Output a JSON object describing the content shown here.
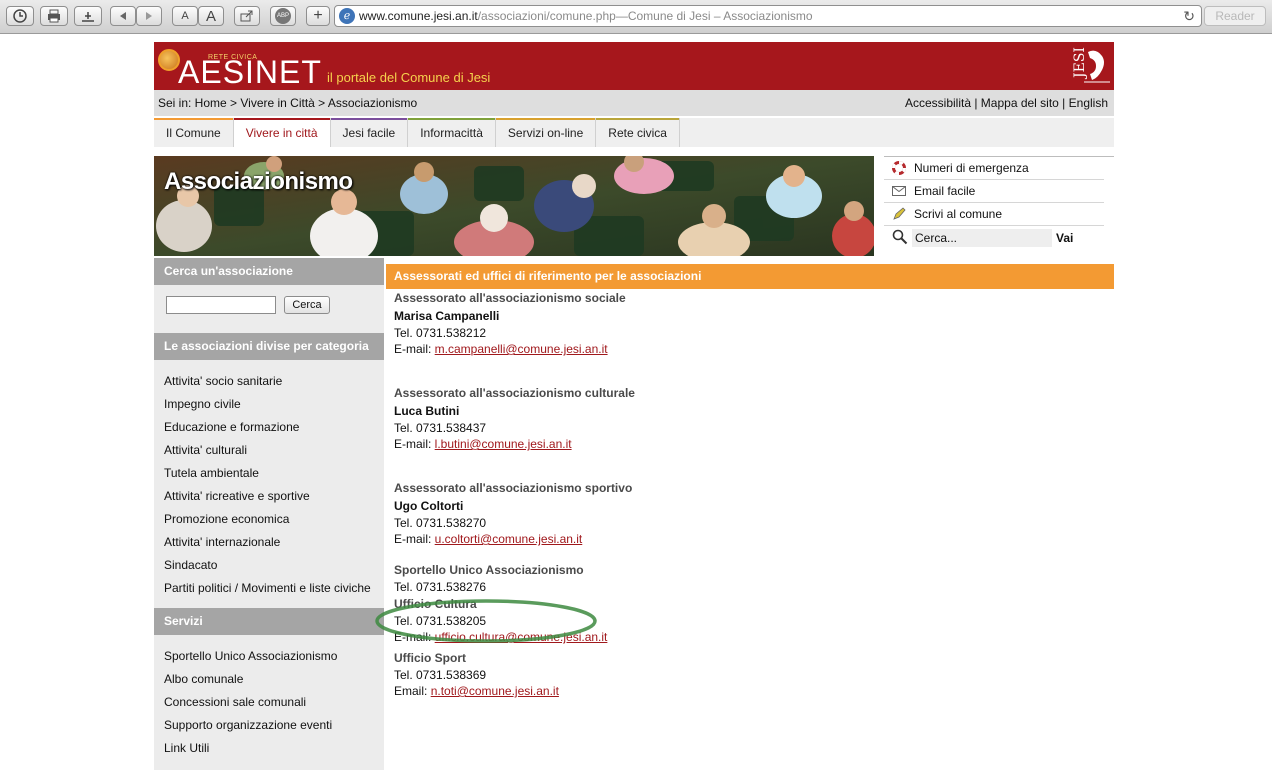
{
  "browser": {
    "url_host": "www.comune.jesi.an.it",
    "url_path": "/associazioni/comune.php",
    "url_sep": " — ",
    "page_title": "Comune di Jesi – Associazionismo",
    "reader_label": "Reader",
    "font_small": "A",
    "font_large": "A",
    "new_tab": "+",
    "abp": "ABP"
  },
  "header": {
    "logo_small": "RETE CIVICA",
    "logo_big": "AESINET",
    "tagline": "il portale del Comune di Jesi",
    "crest_caption": "Comune di Jesi"
  },
  "breadcrumb": {
    "text": "Sei in: Home > Vivere in Città > Associazionismo",
    "links": [
      "Accessibilità",
      "Mappa del sito",
      "English"
    ],
    "separator": " | "
  },
  "nav": {
    "tabs": [
      {
        "label": "Il Comune",
        "color": "#f39a33"
      },
      {
        "label": "Vivere in città",
        "color": "#a6171c"
      },
      {
        "label": "Jesi facile",
        "color": "#7b4e9c"
      },
      {
        "label": "Informacittà",
        "color": "#7fa13a"
      },
      {
        "label": "Servizi on-line",
        "color": "#d8a12e"
      },
      {
        "label": "Rete civica",
        "color": "#b9a53a"
      }
    ],
    "active": "Vivere in città"
  },
  "hero": {
    "title": "Associazionismo"
  },
  "quick": {
    "items": [
      {
        "label": "Numeri di emergenza",
        "icon": "lifebuoy-icon"
      },
      {
        "label": "Email facile",
        "icon": "envelope-icon"
      },
      {
        "label": "Scrivi al comune",
        "icon": "pen-icon"
      }
    ],
    "search_value": "Cerca...",
    "search_button": "Vai"
  },
  "sidebar": {
    "search_head": "Cerca un'associazione",
    "search_button": "Cerca",
    "cat_head": "Le associazioni divise per categoria",
    "categories": [
      "Attivita' socio sanitarie",
      "Impegno civile",
      "Educazione e formazione",
      "Attivita' culturali",
      "Tutela ambientale",
      "Attivita' ricreative e sportive",
      "Promozione economica",
      "Attivita' internazionale",
      "Sindacato",
      "Partiti politici / Movimenti e liste civiche"
    ],
    "services_head": "Servizi",
    "services": [
      "Sportello Unico Associazionismo",
      "Albo comunale",
      "Concessioni sale comunali",
      "Supporto organizzazione eventi",
      "Link Utili"
    ]
  },
  "content": {
    "heading": "Assessorati ed uffici di riferimento per le associazioni",
    "blocks": [
      {
        "title": "Assessorato all'associazionismo sociale",
        "name": "Marisa Campanelli",
        "tel": "Tel. 0731.538212",
        "email_label": "E-mail: ",
        "email": "m.campanelli@comune.jesi.an.it"
      },
      {
        "title": "Assessorato all'associazionismo culturale",
        "name": "Luca Butini",
        "tel": "Tel. 0731.538437",
        "email_label": "E-mail: ",
        "email": "l.butini@comune.jesi.an.it"
      },
      {
        "title": "Assessorato all'associazionismo sportivo",
        "name": "Ugo Coltorti",
        "tel": "Tel. 0731.538270",
        "email_label": "E-mail: ",
        "email": "u.coltorti@comune.jesi.an.it"
      }
    ],
    "sportello": {
      "title": "Sportello Unico Associazionismo",
      "tel": "Tel. 0731.538276"
    },
    "cultura": {
      "title": "Ufficio Cultura",
      "tel": "Tel. 0731.538205",
      "email_label": "E-mail: ",
      "email": "ufficio.cultura@comune.jesi.an.it"
    },
    "sport": {
      "title": "Ufficio Sport",
      "tel": "Tel. 0731.538369",
      "email_label": "Email: ",
      "email": "n.toti@comune.jesi.an.it"
    }
  },
  "annotation": {
    "color": "#3d8a3f"
  }
}
